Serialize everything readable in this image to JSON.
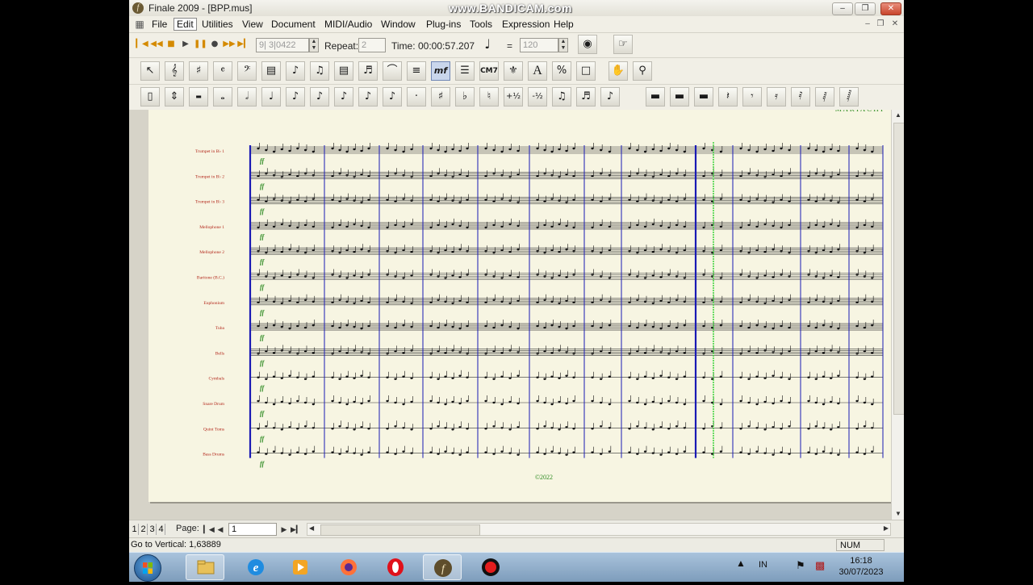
{
  "overlay": {
    "watermark": "www.BANDICAM.com"
  },
  "window": {
    "title": "Finale 2009 - [BPP.mus]"
  },
  "menu": [
    "File",
    "Edit",
    "Utilities",
    "View",
    "Document",
    "MIDI/Audio",
    "Window",
    "Plug-ins",
    "Tools",
    "Expression",
    "Help"
  ],
  "playback": {
    "measure_display": "9| 3|0422",
    "repeat_label": "Repeat:",
    "repeat_value": "2",
    "time_label": "Time:",
    "time_value": "00:00:57.207",
    "equals": "=",
    "tempo_value": "120"
  },
  "score": {
    "instruments": [
      "Trumpet in B♭ 1",
      "Trumpet in B♭ 2",
      "Trumpet in B♭ 3",
      "Mellophone 1",
      "Mellophone 2",
      "Baritone (B.C.)",
      "Euphonium",
      "Tuba",
      "Bells",
      "Cymbals",
      "Snare Drum",
      "Quint Toms",
      "Bass Drums"
    ],
    "copyright": "©2022",
    "dynamic_mark": "ff",
    "header_fragment": "M A R I A C H I"
  },
  "pagebar": {
    "layers": [
      "1",
      "2",
      "3",
      "4"
    ],
    "page_label": "Page:",
    "page_value": "1"
  },
  "status": {
    "message": "Go to Vertical: 1,63889",
    "num": "NUM"
  },
  "tray": {
    "lang": "IN",
    "time": "16:18",
    "date": "30/07/2023"
  }
}
